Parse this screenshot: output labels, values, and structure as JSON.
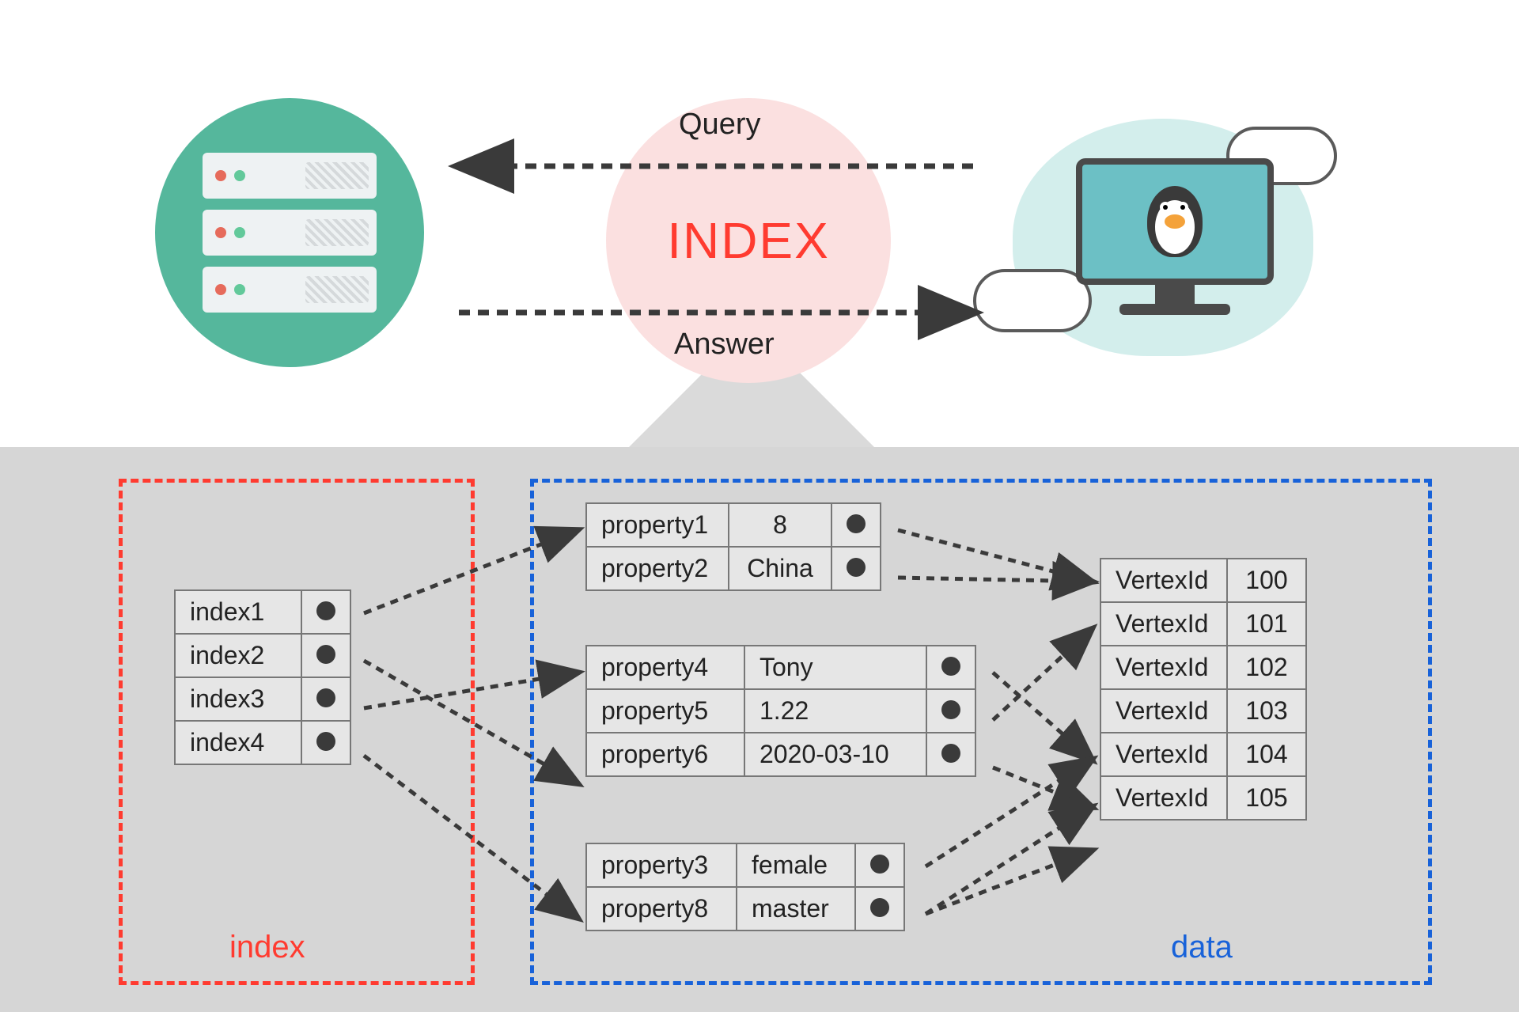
{
  "top": {
    "query_label": "Query",
    "answer_label": "Answer",
    "index_center": "INDEX"
  },
  "boxes": {
    "index_label": "index",
    "data_label": "data"
  },
  "index_table": [
    {
      "name": "index1"
    },
    {
      "name": "index2"
    },
    {
      "name": "index3"
    },
    {
      "name": "index4"
    }
  ],
  "prop_group_a": [
    {
      "key": "property1",
      "value": "8"
    },
    {
      "key": "property2",
      "value": "China"
    }
  ],
  "prop_group_b": [
    {
      "key": "property4",
      "value": "Tony"
    },
    {
      "key": "property5",
      "value": "1.22"
    },
    {
      "key": "property6",
      "value": "2020-03-10"
    }
  ],
  "prop_group_c": [
    {
      "key": "property3",
      "value": "female"
    },
    {
      "key": "property8",
      "value": "master"
    }
  ],
  "vertex_table": [
    {
      "key": "VertexId",
      "value": "100"
    },
    {
      "key": "VertexId",
      "value": "101"
    },
    {
      "key": "VertexId",
      "value": "102"
    },
    {
      "key": "VertexId",
      "value": "103"
    },
    {
      "key": "VertexId",
      "value": "104"
    },
    {
      "key": "VertexId",
      "value": "105"
    }
  ]
}
